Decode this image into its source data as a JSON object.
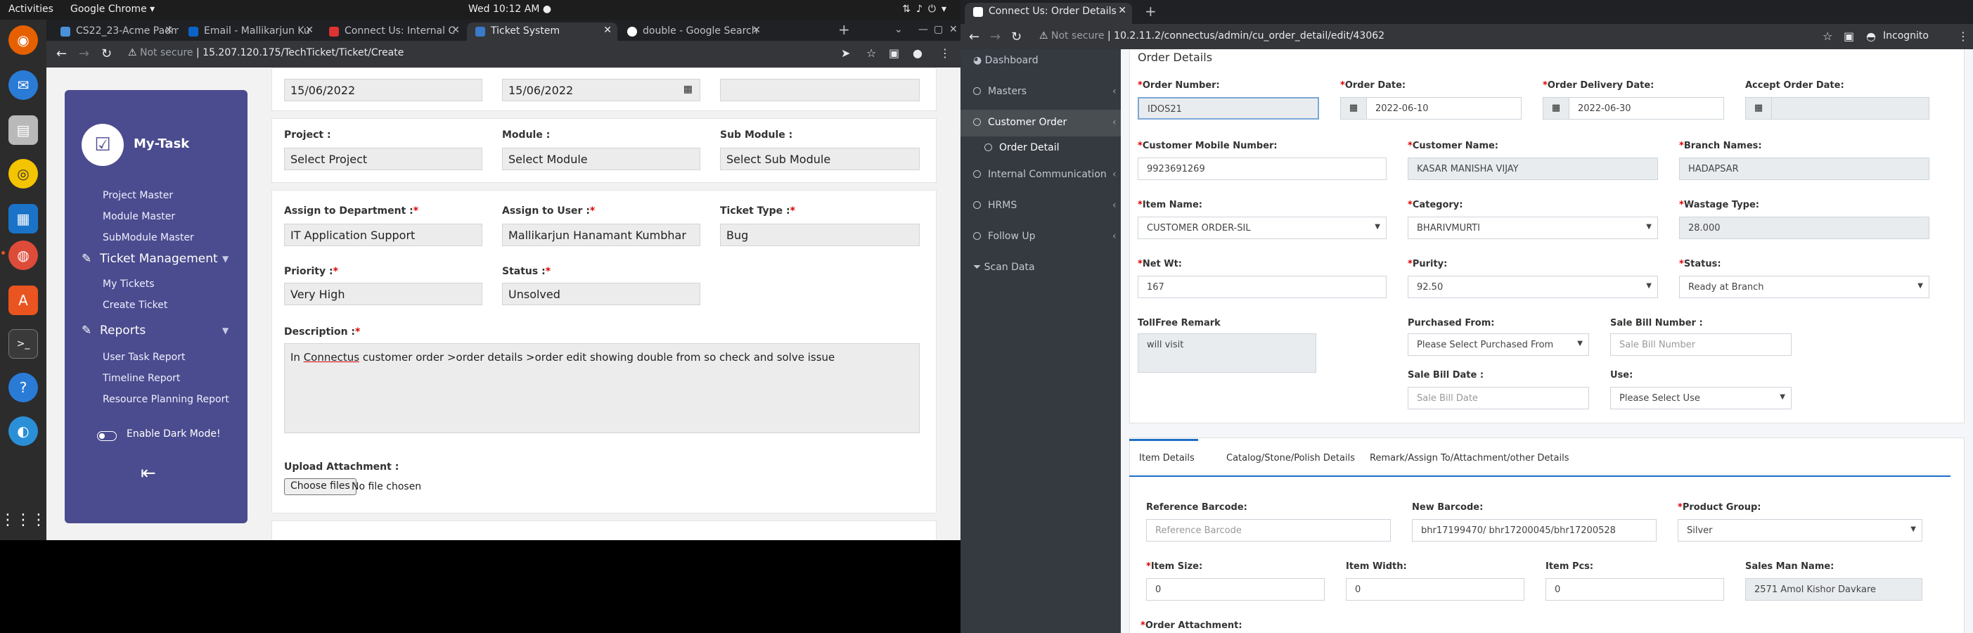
{
  "topbar": {
    "activities": "Activities",
    "app_name": "Google Chrome ▾",
    "clock": "Wed 10:12 AM ●"
  },
  "dock": {
    "icons": [
      "firefox-icon",
      "thunderbird-icon",
      "files-icon",
      "rhythmbox-icon",
      "writer-icon",
      "chrome-icon",
      "software-icon",
      "terminal-icon",
      "help-icon",
      "remmina-icon",
      "apps-grid-icon"
    ]
  },
  "left_browser": {
    "tabs": [
      {
        "label": "CS22_23-Acme Padm E"
      },
      {
        "label": "Email - Mallikarjun Ku"
      },
      {
        "label": "Connect Us: Internal C"
      },
      {
        "label": "Ticket System"
      },
      {
        "label": "double - Google Search"
      }
    ],
    "url_prefix": "Not secure",
    "url": "15.207.120.175/TechTicket/Ticket/Create"
  },
  "mytask": {
    "title": "My-Task",
    "masters": [
      "Project Master",
      "Module Master",
      "SubModule Master"
    ],
    "ticket_management": "Ticket Management",
    "ticket_items": [
      "My Tickets",
      "Create Ticket"
    ],
    "reports": "Reports",
    "report_items": [
      "User Task Report",
      "Timeline Report",
      "Resource Planning Report"
    ],
    "dark_mode": "Enable Dark Mode!"
  },
  "ticket_form": {
    "start_date": "15/06/2022",
    "end_date": "15/06/2022",
    "project_label": "Project :",
    "project_value": "Select Project",
    "module_label": "Module :",
    "module_value": "Select Module",
    "submodule_label": "Sub Module :",
    "submodule_value": "Select Sub Module",
    "dept_label": "Assign to Department :",
    "dept_value": "IT Application Support",
    "user_label": "Assign to User :",
    "user_value": "Mallikarjun Hanamant Kumbhar",
    "type_label": "Ticket Type :",
    "type_value": "Bug",
    "priority_label": "Priority :",
    "priority_value": "Very High",
    "status_label": "Status :",
    "status_value": "Unsolved",
    "desc_label": "Description :",
    "desc_pre": "In ",
    "desc_link": "Connectus",
    "desc_post": " customer order >order details >order edit showing double from so check and solve issue",
    "upload_label": "Upload Attachment :",
    "choose_files": "Choose files",
    "no_file": "No file chosen",
    "required_mark": "*"
  },
  "right_browser": {
    "tab": "Connect Us: Order Details",
    "url_prefix": "Not secure",
    "url": "10.2.11.2/connectus/admin/cu_order_detail/edit/43062",
    "incognito": "Incognito"
  },
  "right_sidebar": {
    "items": [
      {
        "label": "Dashboard"
      },
      {
        "label": "Masters"
      },
      {
        "label": "Customer Order"
      },
      {
        "label": "Order Detail"
      },
      {
        "label": "Internal Communication"
      },
      {
        "label": "HRMS"
      },
      {
        "label": "Follow Up"
      },
      {
        "label": "Scan Data"
      }
    ]
  },
  "order_form": {
    "title": "Order Details",
    "order_number_label": "Order Number:",
    "order_number": "IDOS21",
    "order_date_label": "Order Date:",
    "order_date": "2022-06-10",
    "delivery_date_label": "Order Delivery Date:",
    "delivery_date": "2022-06-30",
    "accept_date_label": "Accept Order Date:",
    "mobile_label": "Customer Mobile Number:",
    "mobile": "9923691269",
    "cust_name_label": "Customer Name:",
    "cust_name": "KASAR MANISHA VIJAY",
    "branch_label": "Branch Names:",
    "branch": "HADAPSAR",
    "item_name_label": "Item Name:",
    "item_name": "CUSTOMER ORDER-SIL",
    "category_label": "Category:",
    "category": "BHARIVMURTI",
    "wastage_label": "Wastage Type:",
    "wastage": "28.000",
    "net_wt_label": "Net Wt:",
    "net_wt": "167",
    "purity_label": "Purity:",
    "purity": "92.50",
    "status_label": "Status:",
    "status": "Ready at Branch",
    "remark_label": "TollFree Remark",
    "remark": "will visit",
    "purchased_label": "Purchased From:",
    "purchased": "Please Select Purchased From",
    "sale_bill_no_label": "Sale Bill Number :",
    "sale_bill_no_ph": "Sale Bill Number",
    "sale_bill_date_label": "Sale Bill Date :",
    "sale_bill_date_ph": "Sale Bill Date",
    "use_label": "Use:",
    "use": "Please Select Use",
    "tabs": [
      "Item Details",
      "Catalog/Stone/Polish Details",
      "Remark/Assign To/Attachment/other Details"
    ],
    "ref_barcode_label": "Reference Barcode:",
    "ref_barcode_ph": "Reference Barcode",
    "new_barcode_label": "New Barcode:",
    "new_barcode": "bhr17199470/ bhr17200045/bhr17200528",
    "product_group_label": "Product Group:",
    "product_group": "Silver",
    "item_size_label": "Item Size:",
    "item_size": "0",
    "item_width_label": "Item Width:",
    "item_width": "0",
    "item_pcs_label": "Item Pcs:",
    "item_pcs": "0",
    "salesman_label": "Sales Man Name:",
    "salesman": "2571 Amol Kishor Davkare",
    "attachment_label": "Order Attachment:",
    "required_mark": "*"
  }
}
